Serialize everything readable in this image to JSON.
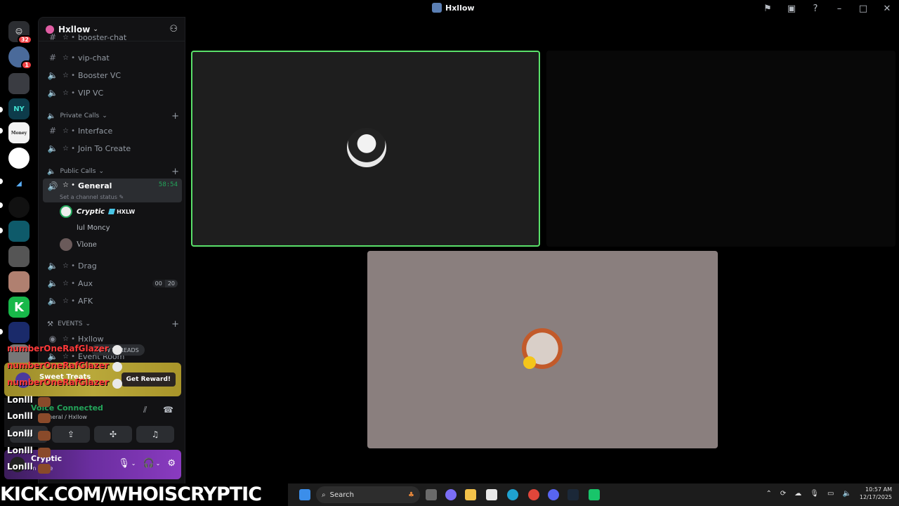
{
  "window": {
    "title": "Hxllow"
  },
  "guild": {
    "name": "Hxllow"
  },
  "channels": {
    "booster_chat": "booster-chat",
    "vip_chat": "vip-chat",
    "booster_vc": "Booster VC",
    "vip_vc": "VIP VC",
    "cat_private": "Private Calls",
    "interface": "Interface",
    "join_to_create": "Join To Create",
    "cat_public": "Public Calls",
    "general": "General",
    "general_timer": "58:54",
    "general_status": "Set a channel status",
    "drag": "Drag",
    "aux": "Aux",
    "aux_count_a": "00",
    "aux_count_b": "20",
    "afk": "AFK",
    "cat_events": "EVENTS",
    "hxllow_stage": "Hxllow",
    "event_room": "Event Room"
  },
  "members": [
    {
      "name": "Cryptic",
      "tag": "HXLW"
    },
    {
      "name": "lul Moncy"
    },
    {
      "name": "Vlone"
    }
  ],
  "new_threads": "NEW THREADS",
  "overlay": {
    "name": "numberOneRafGlazer",
    "lonlll": "Lonlll"
  },
  "reward": {
    "text": "Sweet Treats",
    "button": "Get Reward!"
  },
  "voice": {
    "status": "Voice Connected",
    "location": "General / Hxllow"
  },
  "user": {
    "name": "Cryptic",
    "status": "In Voice"
  },
  "servers": {
    "home_badge": "32",
    "dm_badge": "1",
    "ny": "NY",
    "money": "Money",
    "k": "K"
  },
  "banner": "KICK.COM/WHOISCRYPTIC",
  "taskbar": {
    "search": "Search",
    "time": "10:57 AM",
    "date": "12/17/2025"
  },
  "colors": {
    "speaking": "#5ae06a",
    "accent": "#23a55a",
    "danger": "#f23f43"
  }
}
